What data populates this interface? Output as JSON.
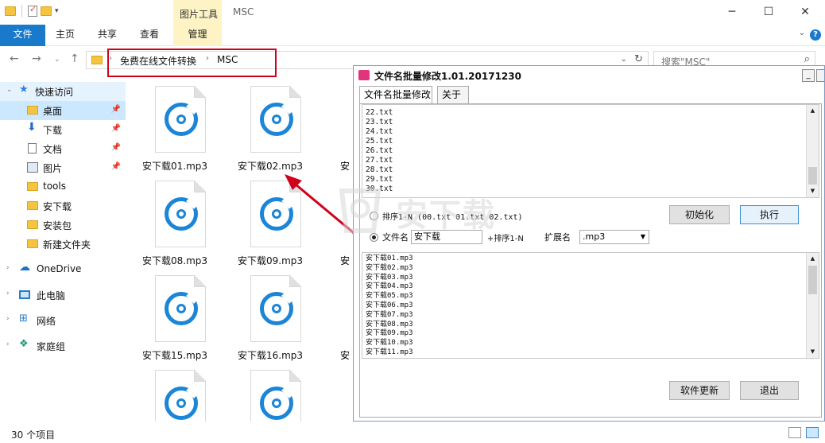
{
  "explorer": {
    "title": "MSC",
    "context_tab_group": "图片工具",
    "ribbon_tabs": [
      "文件",
      "主页",
      "共享",
      "查看",
      "管理"
    ],
    "breadcrumb": [
      "免费在线文件转换",
      "MSC"
    ],
    "search_placeholder": "搜索\"MSC\"",
    "status_count": "30 个项目",
    "nav": {
      "quick_access": "快速访问",
      "items": [
        "桌面",
        "下载",
        "文档",
        "图片",
        "tools",
        "安下载",
        "安装包",
        "新建文件夹"
      ],
      "onedrive": "OneDrive",
      "this_pc": "此电脑",
      "network": "网络",
      "homegroup": "家庭组"
    },
    "files": [
      "安下载01.mp3",
      "安下载02.mp3",
      "安下载08.mp3",
      "安下载09.mp3",
      "安下载15.mp3",
      "安下载16.mp3",
      "",
      ""
    ],
    "partial_label": "安"
  },
  "dialog": {
    "title": "文件名批量修改1.01.20171230",
    "tabs": [
      "文件名批量修改",
      "关于"
    ],
    "source_list": [
      "22.txt",
      "23.txt",
      "24.txt",
      "25.txt",
      "26.txt",
      "27.txt",
      "28.txt",
      "29.txt",
      "30.txt"
    ],
    "option_sort_label": "排序1-N (00.txt 01.txt 02.txt)",
    "btn_init": "初始化",
    "btn_execute": "执行",
    "option_name_label": "文件名",
    "name_value": "安下载",
    "sort_suffix_label": "+排序1-N",
    "ext_label": "扩展名",
    "ext_value": ".mp3",
    "result_list": [
      "安下载01.mp3",
      "安下载02.mp3",
      "安下载03.mp3",
      "安下载04.mp3",
      "安下载05.mp3",
      "安下载06.mp3",
      "安下载07.mp3",
      "安下载08.mp3",
      "安下载09.mp3",
      "安下载10.mp3",
      "安下载11.mp3"
    ],
    "btn_update": "软件更新",
    "btn_exit": "退出"
  },
  "watermark": "安下载",
  "colors": {
    "accent": "#1979ca",
    "highlight_box": "#d0021b",
    "file_icon": "#1b85d8"
  }
}
